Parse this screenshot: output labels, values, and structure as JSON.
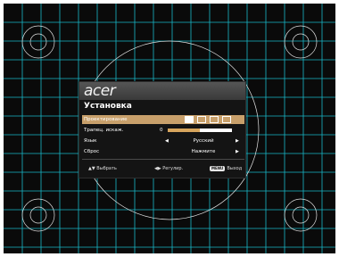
{
  "brand": "acer",
  "menu_title": "Установка",
  "rows": [
    {
      "label": "Проектирование",
      "selected": true
    },
    {
      "label": "Трапец. искаж.",
      "value": "0",
      "level_fraction": 0.5
    },
    {
      "label": "Язык",
      "value": "Русский"
    },
    {
      "label": "Сброс",
      "value": "Нажмите"
    }
  ],
  "projection_modes": [
    {
      "icon": "front-projection-icon",
      "active": true
    },
    {
      "icon": "rear-projection-icon",
      "active": false
    },
    {
      "icon": "ceiling-projection-icon",
      "active": false
    },
    {
      "icon": "rear-ceiling-projection-icon",
      "active": false
    }
  ],
  "footer": {
    "select_label": "Выбрать",
    "adjust_label": "Регулир.",
    "menu_key": "MENU",
    "exit_label": "Выход"
  },
  "colors": {
    "grid_line": "#19b8c8",
    "background": "#0a0a0a",
    "selected_row": "#c8a06b",
    "slider_fill": "#d7a55d"
  }
}
